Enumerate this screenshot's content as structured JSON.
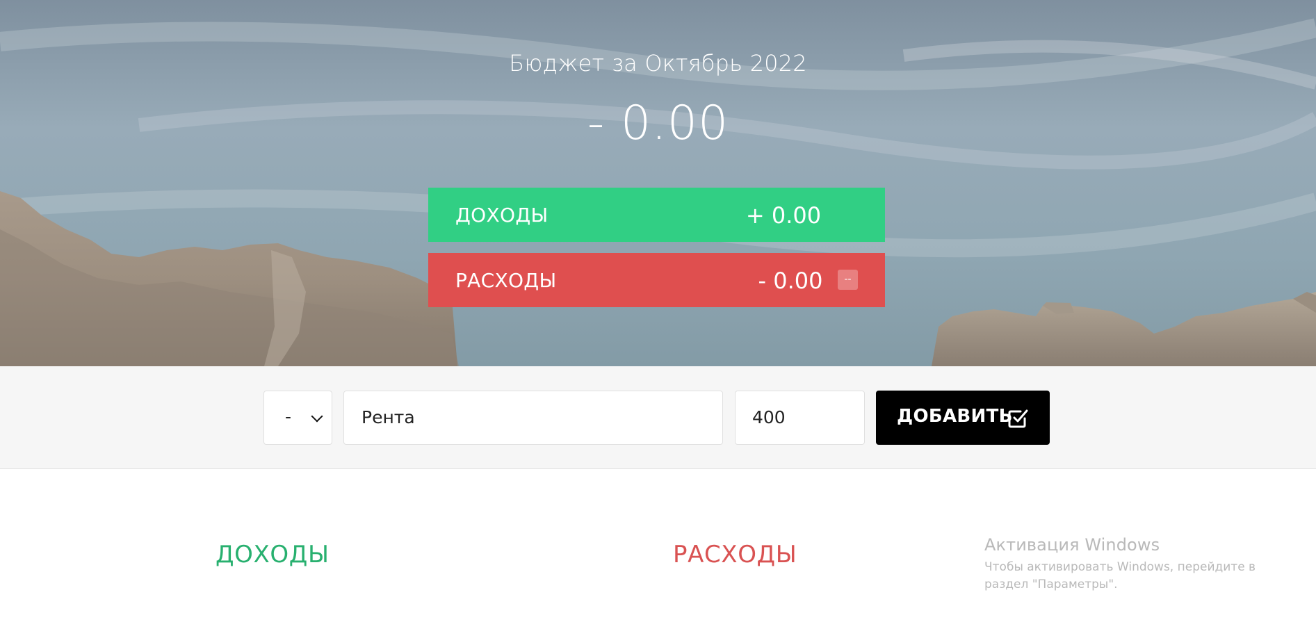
{
  "header": {
    "title": "Бюджет за Октябрь 2022",
    "total": "- 0.00"
  },
  "summary": {
    "income": {
      "label": "ДОХОДЫ",
      "value": "+ 0.00"
    },
    "expenses": {
      "label": "РАСХОДЫ",
      "value": "- 0.00",
      "percent": "--"
    }
  },
  "add_form": {
    "type_select": {
      "value": "-"
    },
    "description": {
      "value": "Рента"
    },
    "amount": {
      "value": "400"
    },
    "submit_label": "ДОБАВИТЬ",
    "submit_icon": "check-square-icon"
  },
  "lists": {
    "income_title": "ДОХОДЫ",
    "expenses_title": "РАСХОДЫ"
  },
  "windows_watermark": {
    "title": "Активация Windows",
    "text": "Чтобы активировать Windows, перейдите в раздел \"Параметры\"."
  },
  "colors": {
    "income": "#31cf84",
    "expense": "#df4f4f",
    "income_text": "#28b06f",
    "expense_text": "#d95252",
    "button": "#000000",
    "add_bar_bg": "#f6f6f6"
  }
}
